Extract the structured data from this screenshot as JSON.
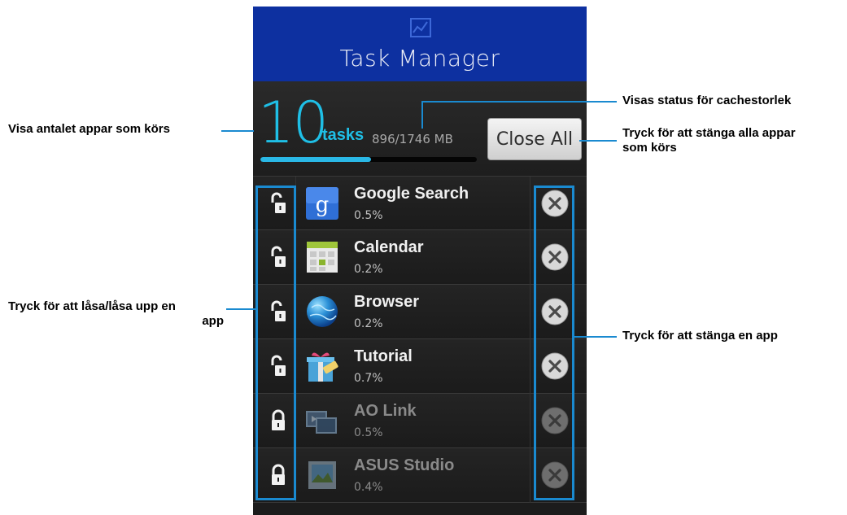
{
  "app": {
    "title": "Task Manager",
    "icon": "chart-icon"
  },
  "status": {
    "task_count": "10",
    "task_unit": "tasks",
    "cache": "896/1746 MB",
    "cache_fraction": 0.513,
    "close_all_label": "Close All"
  },
  "tasks": [
    {
      "name": "Google Search",
      "percent": "0.5%",
      "icon": "google-search-icon",
      "locked": false
    },
    {
      "name": "Calendar",
      "percent": "0.2%",
      "icon": "calendar-icon",
      "locked": false
    },
    {
      "name": "Browser",
      "percent": "0.2%",
      "icon": "browser-globe-icon",
      "locked": false
    },
    {
      "name": "Tutorial",
      "percent": "0.7%",
      "icon": "tutorial-gift-icon",
      "locked": false
    },
    {
      "name": "AO Link",
      "percent": "0.5%",
      "icon": "ao-link-icon",
      "locked": true
    },
    {
      "name": "ASUS Studio",
      "percent": "0.4%",
      "icon": "asus-studio-icon",
      "locked": true
    }
  ],
  "annotations": {
    "count": "Visa antalet appar som körs",
    "cache": "Visas status för cachestorlek",
    "close_all_1": "Tryck för att stänga alla appar",
    "close_all_2": "som körs",
    "lock_1": "Tryck för att låsa/låsa upp en",
    "lock_2": "app",
    "close_one": "Tryck för att stänga en app"
  },
  "colors": {
    "titlebar": "#0d30a0",
    "accent": "#1fbfe6",
    "annotation": "#1a8ad0"
  }
}
